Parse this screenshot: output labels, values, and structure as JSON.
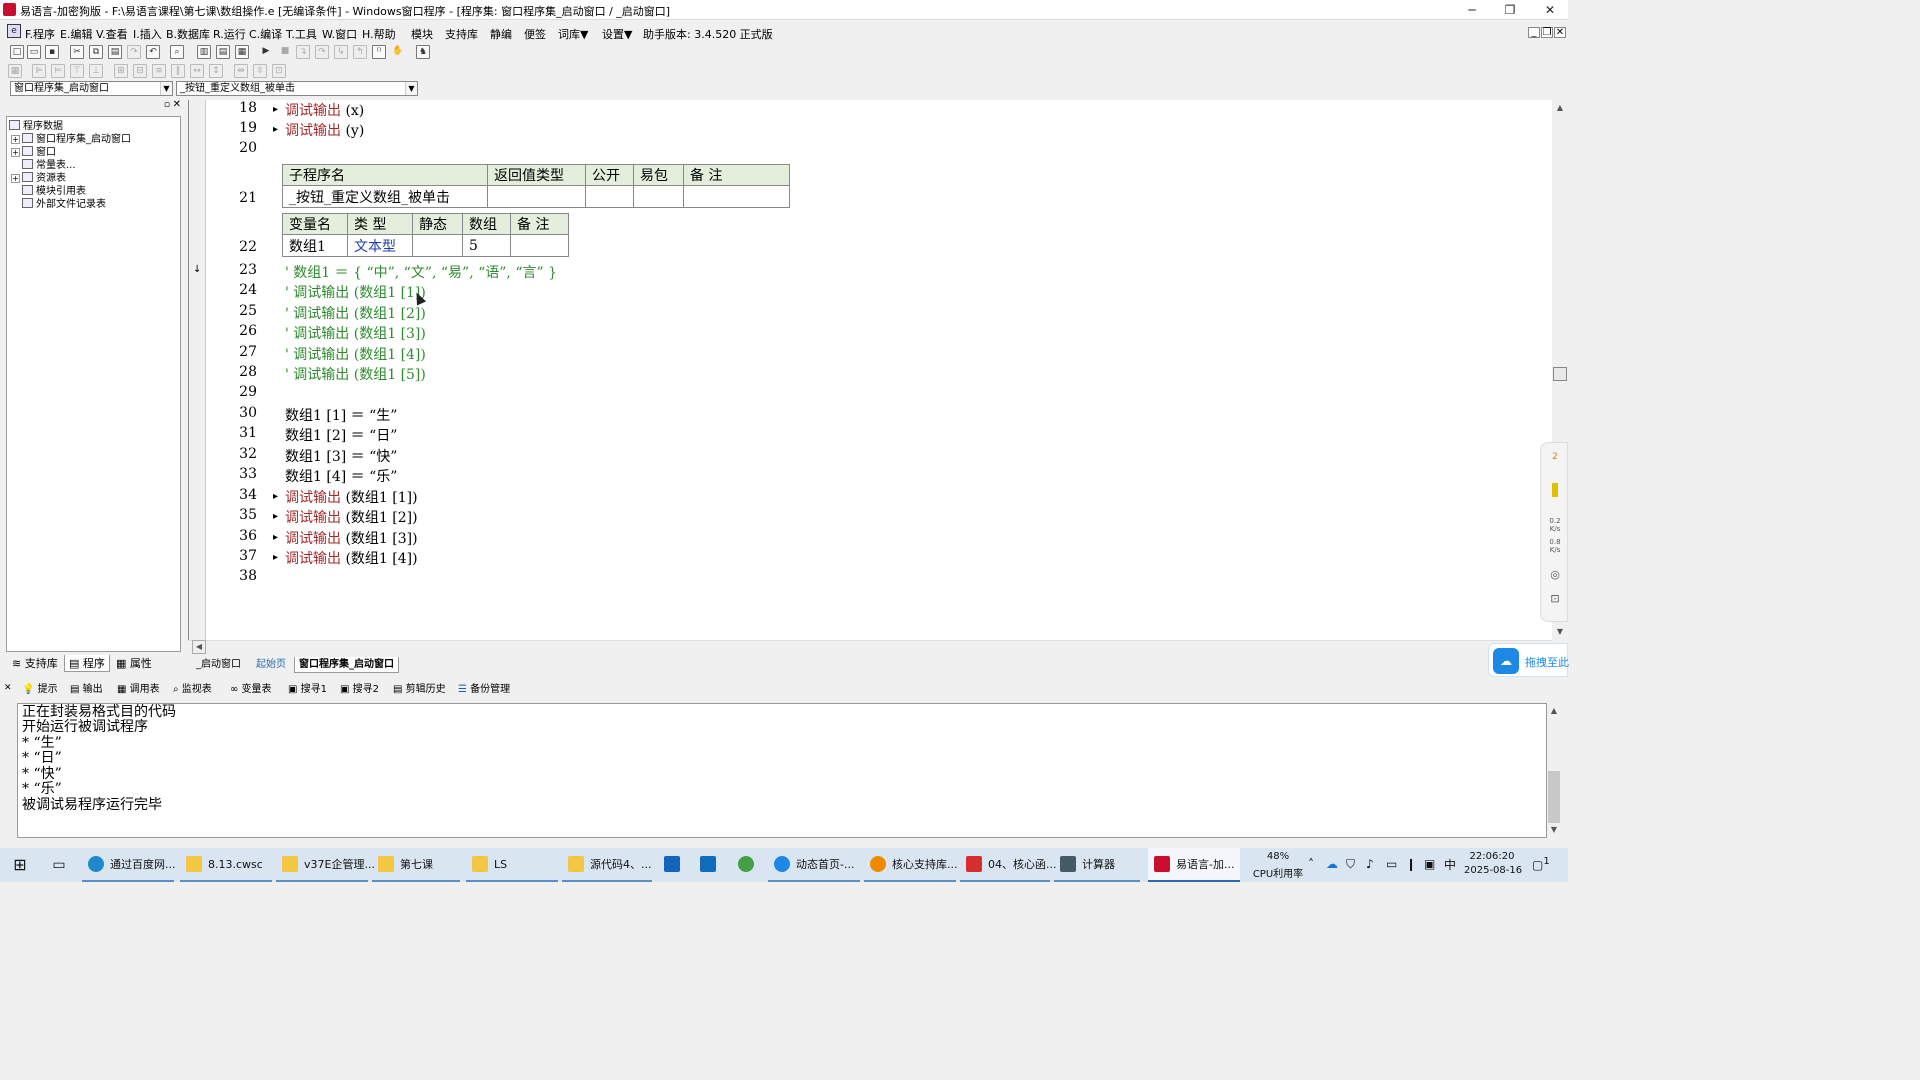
{
  "window": {
    "title": "易语言-加密狗版 - F:\\易语言课程\\第七课\\数组操作.e [无编译条件] - Windows窗口程序 - [程序集: 窗口程序集_启动窗口 / _启动窗口]",
    "minimize": "─",
    "maximize": "❐",
    "close": "✕"
  },
  "menu": {
    "items": [
      "F.程序",
      "E.编辑",
      "V.查看",
      "I.插入",
      "B.数据库",
      "R.运行",
      "C.编译",
      "T.工具",
      "W.窗口",
      "H.帮助",
      "模块",
      "支持库",
      "静编",
      "便签",
      "词库▼",
      "设置▼",
      "助手版本: 3.4.520 正式版"
    ],
    "mdi_min": "_",
    "mdi_restore": "❐",
    "mdi_close": "✕"
  },
  "selectors": {
    "assembly": "窗口程序集_启动窗口",
    "subroutine": "_按钮_重定义数组_被单击"
  },
  "tree": {
    "root": "程序数据",
    "items": [
      "窗口程序集_启动窗口",
      "窗口",
      "常量表...",
      "资源表",
      "模块引用表",
      "外部文件记录表"
    ]
  },
  "left_tabs": [
    "支持库",
    "程序",
    "属性"
  ],
  "code": {
    "l18": {
      "num": "18",
      "fn": "调试输出",
      "arg": " (x)"
    },
    "l19": {
      "num": "19",
      "fn": "调试输出",
      "arg": " (y)"
    },
    "l20": {
      "num": "20"
    },
    "l21": {
      "num": "21"
    },
    "sub_header": [
      "子程序名",
      "返回值类型",
      "公开",
      "易包",
      "备 注"
    ],
    "sub_row": [
      "_按钮_重定义数组_被单击",
      "",
      "",
      "",
      ""
    ],
    "l22": {
      "num": "22"
    },
    "var_header": [
      "变量名",
      "类 型",
      "静态",
      "数组",
      "备 注"
    ],
    "var_row": [
      "数组1",
      "文本型",
      "",
      "5",
      ""
    ],
    "l23": {
      "num": "23",
      "text": "' 数组1 ＝ { “中”, “文”, “易”, “语”, “言” }"
    },
    "l24": {
      "num": "24",
      "text": "' 调试输出 (数组1 [1])"
    },
    "l25": {
      "num": "25",
      "text": "' 调试输出 (数组1 [2])"
    },
    "l26": {
      "num": "26",
      "text": "' 调试输出 (数组1 [3])"
    },
    "l27": {
      "num": "27",
      "text": "' 调试输出 (数组1 [4])"
    },
    "l28": {
      "num": "28",
      "text": "' 调试输出 (数组1 [5])"
    },
    "l29": {
      "num": "29"
    },
    "l30": {
      "num": "30",
      "text": "数组1 [1] ＝ “生”"
    },
    "l31": {
      "num": "31",
      "text": "数组1 [2] ＝ “日”"
    },
    "l32": {
      "num": "32",
      "text": "数组1 [3] ＝ “快”"
    },
    "l33": {
      "num": "33",
      "text": "数组1 [4] ＝ “乐”"
    },
    "l34": {
      "num": "34",
      "fn": "调试输出",
      "arg": " (数组1 [1])"
    },
    "l35": {
      "num": "35",
      "fn": "调试输出",
      "arg": " (数组1 [2])"
    },
    "l36": {
      "num": "36",
      "fn": "调试输出",
      "arg": " (数组1 [3])"
    },
    "l37": {
      "num": "37",
      "fn": "调试输出",
      "arg": " (数组1 [4])"
    },
    "l38": {
      "num": "38"
    },
    "bullet": "▸"
  },
  "doc_tabs": [
    "_启动窗口",
    "起始页",
    "窗口程序集_启动窗口"
  ],
  "bottom_tabs": [
    "提示",
    "输出",
    "调用表",
    "监视表",
    "变量表",
    "搜寻1",
    "搜寻2",
    "剪辑历史",
    "备份管理"
  ],
  "output_lines": [
    "正在封装易格式目的代码",
    "开始运行被调试程序",
    "* “生”",
    "* “日”",
    "* “快”",
    "* “乐”",
    "被调试易程序运行完毕"
  ],
  "float_panel": {
    "badge": "2",
    "net1": "0.2",
    "net1_unit": "K/s",
    "net2": "0.8",
    "net2_unit": "K/s"
  },
  "drag_button": {
    "label": "拖拽至此"
  },
  "taskbar": {
    "apps": [
      "通过百度网...",
      "8.13.cwsc",
      "v37E企管理...",
      "第七课",
      "LS",
      "源代码4、...",
      "",
      "",
      "",
      "动态首页-...",
      "核心支持库...",
      "04、核心函...",
      "计算器",
      "易语言-加..."
    ],
    "cpu_percent": "48%",
    "cpu_label": "CPU利用率",
    "ime": "中",
    "time": "22:06:20",
    "date": "2025-08-16",
    "notif": "1"
  },
  "colors": {
    "function": "#a52a2a",
    "comment": "#2e8b2e",
    "table_header": "#e3efdc",
    "accent": "#1e88e5"
  }
}
